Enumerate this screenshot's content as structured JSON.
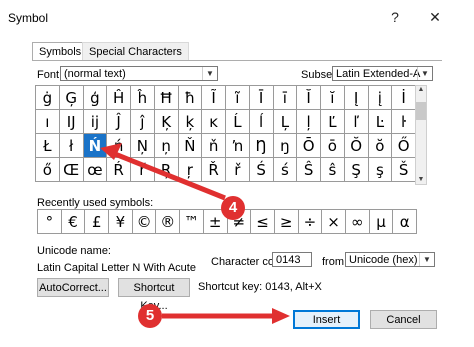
{
  "dialog": {
    "title": "Symbol",
    "help_glyph": "?",
    "close_glyph": "✕"
  },
  "tabs": [
    {
      "label": "Symbols"
    },
    {
      "label": "Special Characters"
    }
  ],
  "font": {
    "label": "Font:",
    "value": "(normal text)"
  },
  "subset": {
    "label": "Subset:",
    "value": "Latin Extended-A"
  },
  "symbols": [
    [
      "ġ",
      "Ģ",
      "ģ",
      "Ĥ",
      "ĥ",
      "Ħ",
      "ħ",
      "Ĩ",
      "ĩ",
      "Ī",
      "ī",
      "Ĭ",
      "ĭ",
      "Į",
      "į",
      "İ"
    ],
    [
      "ı",
      "Ĳ",
      "ĳ",
      "Ĵ",
      "ĵ",
      "Ķ",
      "ķ",
      "ĸ",
      "Ĺ",
      "ĺ",
      "Ļ",
      "ļ",
      "Ľ",
      "ľ",
      "Ŀ",
      "ŀ"
    ],
    [
      "Ł",
      "ł",
      "Ń",
      "ń",
      "Ņ",
      "ņ",
      "Ň",
      "ň",
      "ŉ",
      "Ŋ",
      "ŋ",
      "Ō",
      "ō",
      "Ŏ",
      "ŏ",
      "Ő"
    ],
    [
      "ő",
      "Œ",
      "œ",
      "Ŕ",
      "ŕ",
      "Ŗ",
      "ŗ",
      "Ř",
      "ř",
      "Ś",
      "ś",
      "Ŝ",
      "ŝ",
      "Ş",
      "ş",
      "Š"
    ]
  ],
  "selected_symbol": "Ń",
  "recent": {
    "label": "Recently used symbols:",
    "items": [
      "°",
      "€",
      "£",
      "¥",
      "©",
      "®",
      "™",
      "±",
      "≠",
      "≤",
      "≥",
      "÷",
      "×",
      "∞",
      "μ",
      "α"
    ]
  },
  "unicode_name": {
    "label": "Unicode name:",
    "value": "Latin Capital Letter N With Acute"
  },
  "char_code": {
    "label": "Character code:",
    "value": "0143"
  },
  "from": {
    "label": "from:",
    "value": "Unicode (hex)"
  },
  "buttons": {
    "autocorrect": "AutoCorrect...",
    "shortcut_key": "Shortcut Key...",
    "insert": "Insert",
    "cancel": "Cancel"
  },
  "shortcut_text": "Shortcut key: 0143, Alt+X",
  "annotations": {
    "step4": "4",
    "step5": "5",
    "color": "#e03030"
  }
}
